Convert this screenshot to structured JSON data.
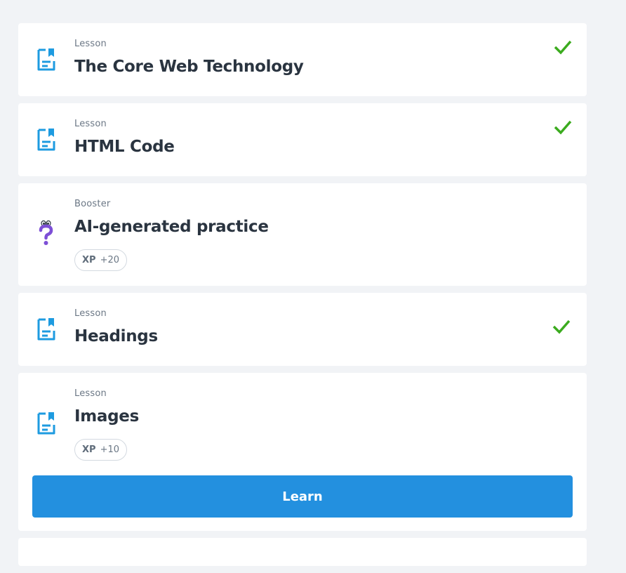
{
  "colors": {
    "background": "#f1f3f6",
    "card": "#ffffff",
    "icon_blue": "#1e9be0",
    "check_green": "#3bab1e",
    "booster_purple": "#7d4fd6",
    "button_blue": "#2390df"
  },
  "items": [
    {
      "type": "Lesson",
      "title": "The Core Web Technology",
      "icon": "lesson-document-icon",
      "completed": true
    },
    {
      "type": "Lesson",
      "title": "HTML Code",
      "icon": "lesson-document-icon",
      "completed": true
    },
    {
      "type": "Booster",
      "title": "AI-generated practice",
      "icon": "question-mark-icon",
      "completed": false,
      "xp_label": "XP",
      "xp_value": "+20"
    },
    {
      "type": "Lesson",
      "title": "Headings",
      "icon": "lesson-document-icon",
      "completed": true
    },
    {
      "type": "Lesson",
      "title": "Images",
      "icon": "lesson-document-icon",
      "completed": false,
      "xp_label": "XP",
      "xp_value": "+10",
      "action_label": "Learn"
    }
  ]
}
